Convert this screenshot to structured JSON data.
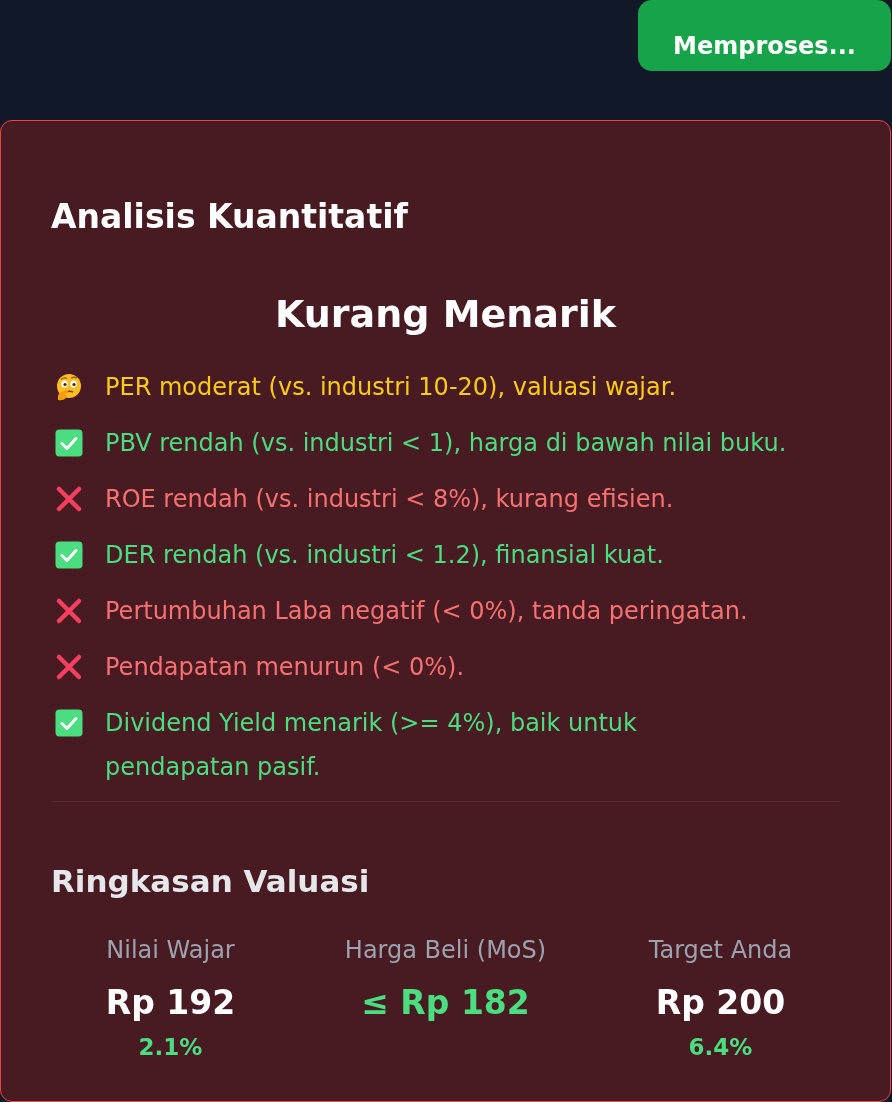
{
  "header": {
    "button": "Memproses..."
  },
  "card": {
    "title": "Analisis Kuantitatif",
    "verdict": "Kurang Menarik",
    "points": [
      {
        "kind": "neutral",
        "text": "PER moderat (vs. industri 10-20), valuasi wajar."
      },
      {
        "kind": "good",
        "text": "PBV rendah (vs. industri < 1), harga di bawah nilai buku."
      },
      {
        "kind": "bad",
        "text": "ROE rendah (vs. industri < 8%), kurang efisien."
      },
      {
        "kind": "good",
        "text": "DER rendah (vs. industri < 1.2), finansial kuat."
      },
      {
        "kind": "bad",
        "text": "Pertumbuhan Laba negatif (< 0%), tanda peringatan."
      },
      {
        "kind": "bad",
        "text": "Pendapatan menurun (< 0%)."
      },
      {
        "kind": "good",
        "text": "Dividend Yield menarik (>= 4%), baik untuk\npendapatan pasif."
      }
    ],
    "summary": {
      "title": "Ringkasan Valuasi",
      "metrics": [
        {
          "kind": "plain",
          "label": "Nilai Wajar",
          "value": "Rp 192",
          "note": "2.1%"
        },
        {
          "kind": "highlight",
          "label": "Harga Beli (MoS)",
          "value": "≤ Rp 182"
        },
        {
          "kind": "plain",
          "label": "Target Anda",
          "value": "Rp 200",
          "note": "6.4%"
        }
      ]
    }
  }
}
